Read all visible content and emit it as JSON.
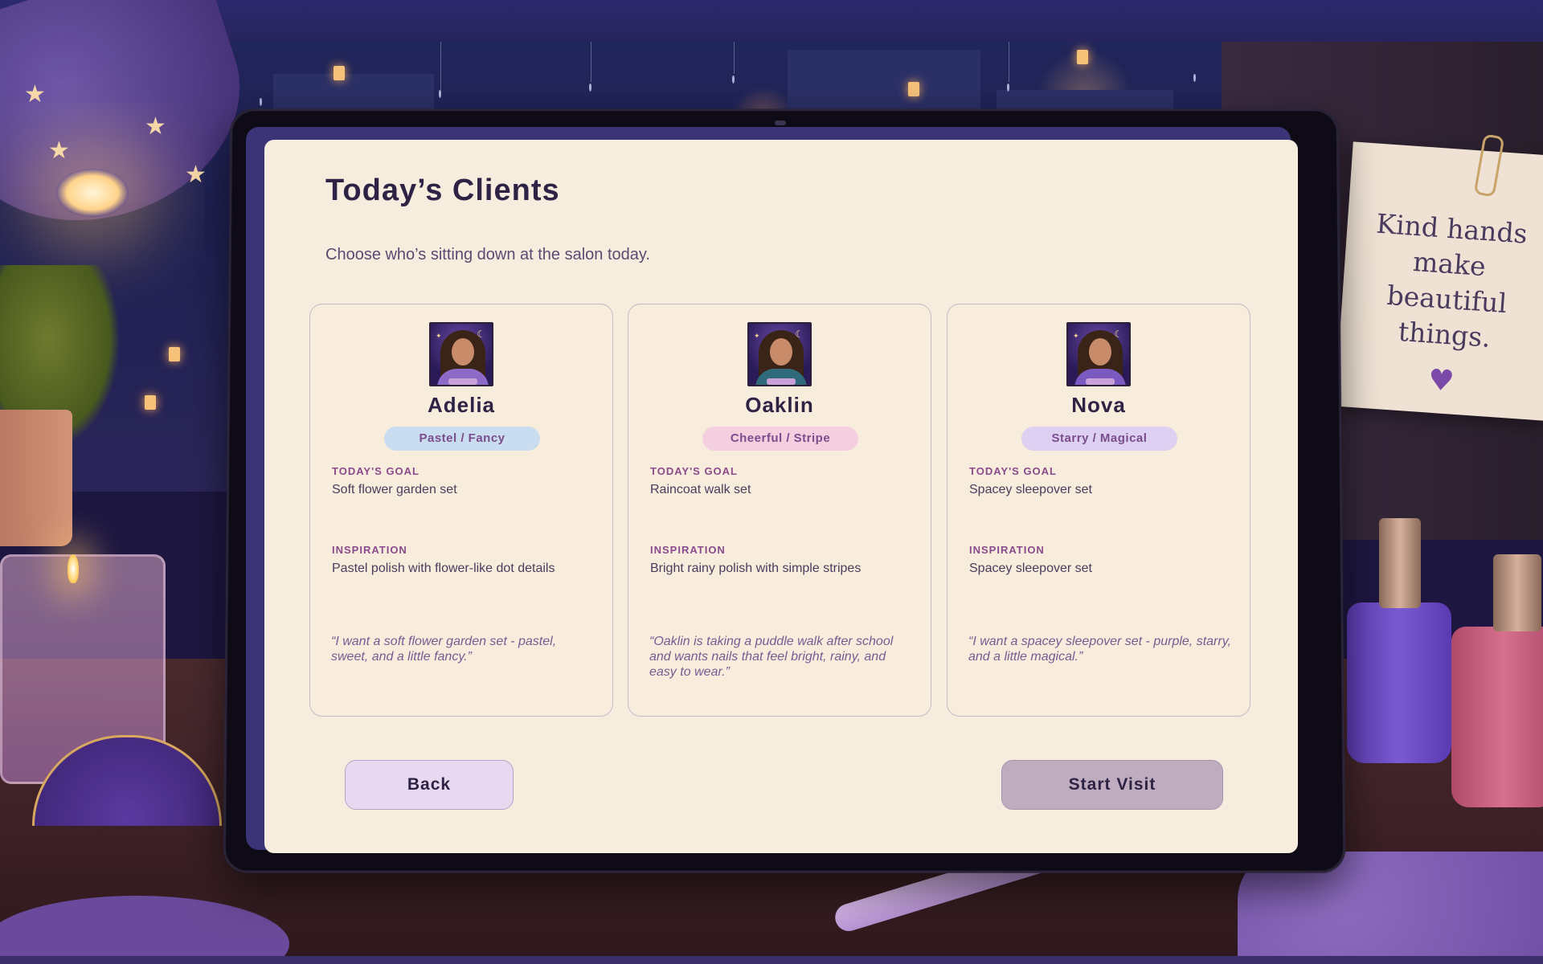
{
  "screen": {
    "title": "Today’s Clients",
    "subtitle": "Choose who’s sitting down at the salon today."
  },
  "clients": [
    {
      "name": "Adelia",
      "style_tag": "Pastel / Fancy",
      "tag_color": "#c9dcf0",
      "goal_label": "TODAY'S GOAL",
      "goal": "Soft flower garden set",
      "inspiration_label": "INSPIRATION",
      "inspiration": "Pastel polish with flower-like dot details",
      "quote": "“I want a soft flower garden set - pastel, sweet, and a little fancy.”"
    },
    {
      "name": "Oaklin",
      "style_tag": "Cheerful / Stripe",
      "tag_color": "#f4cfe0",
      "goal_label": "TODAY'S GOAL",
      "goal": "Raincoat walk set",
      "inspiration_label": "INSPIRATION",
      "inspiration": "Bright rainy polish with simple stripes",
      "quote": "“Oaklin is taking a puddle walk after school and wants nails that feel bright, rainy, and easy to wear.”"
    },
    {
      "name": "Nova",
      "style_tag": "Starry / Magical",
      "tag_color": "#ddd0f2",
      "goal_label": "TODAY'S GOAL",
      "goal": "Spacey sleepover set",
      "inspiration_label": "INSPIRATION",
      "inspiration": "Spacey sleepover set",
      "quote": "“I want a spacey sleepover set - purple, starry, and a little magical.”"
    }
  ],
  "buttons": {
    "back": "Back",
    "start": "Start Visit"
  },
  "decor": {
    "note_text": [
      "Kind hands",
      "make",
      "beautiful",
      "things."
    ],
    "note_icon": "heart-icon"
  }
}
